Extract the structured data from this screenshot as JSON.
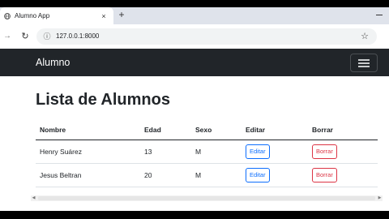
{
  "browser": {
    "tab_title": "Alumno App",
    "tab_close": "×",
    "new_tab": "+",
    "url": "127.0.0.1:8000",
    "icons": [
      "globe-icon",
      "close-icon",
      "plus-icon",
      "minimize-icon",
      "back-arrow-icon",
      "reload-icon",
      "site-info-icon",
      "star-icon"
    ]
  },
  "navbar": {
    "brand": "Alumno",
    "background": "#212529",
    "toggler_icon": "hamburger-menu-icon"
  },
  "page": {
    "heading": "Lista de Alumnos"
  },
  "table": {
    "headers": [
      "Nombre",
      "Edad",
      "Sexo",
      "Editar",
      "Borrar"
    ],
    "rows": [
      {
        "nombre": "Henry Suárez",
        "edad": "13",
        "sexo": "M",
        "edit_label": "Editar",
        "delete_label": "Borrar"
      },
      {
        "nombre": "Jesus Beltran",
        "edad": "20",
        "sexo": "M",
        "edit_label": "Editar",
        "delete_label": "Borrar"
      }
    ]
  },
  "colors": {
    "edit_button": "#0d6efd",
    "delete_button": "#dc3545"
  }
}
